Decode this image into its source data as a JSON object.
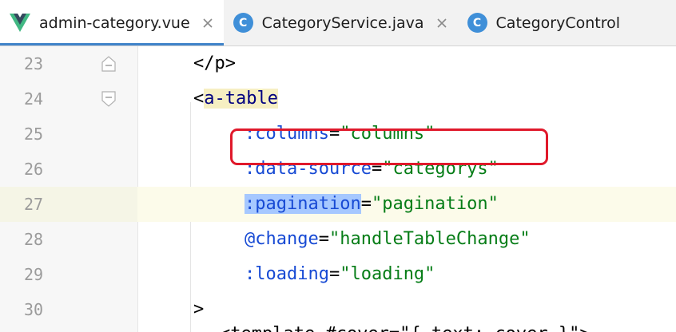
{
  "tabs": [
    {
      "label": "admin-category.vue",
      "icon": "vue-icon",
      "active": true
    },
    {
      "label": "CategoryService.java",
      "icon": "class-icon",
      "active": false
    },
    {
      "label": "CategoryControl",
      "icon": "class-icon",
      "active": false
    }
  ],
  "class_icon_letter": "C",
  "close_glyph": "✕",
  "editor": {
    "lines": [
      {
        "number": "23",
        "tokens": [
          {
            "t": "</p>",
            "k": "punc"
          }
        ]
      },
      {
        "number": "24",
        "tokens": [
          {
            "t": "<",
            "k": "punc"
          },
          {
            "t": "a-table",
            "k": "tag"
          }
        ]
      },
      {
        "number": "25",
        "tokens": [
          {
            "t": ":columns",
            "k": "attr"
          },
          {
            "t": "=",
            "k": "eq"
          },
          {
            "t": "\"columns\"",
            "k": "val"
          }
        ]
      },
      {
        "number": "26",
        "tokens": [
          {
            "t": ":data-source",
            "k": "attr"
          },
          {
            "t": "=",
            "k": "eq"
          },
          {
            "t": "\"categorys\"",
            "k": "val"
          }
        ]
      },
      {
        "number": "27",
        "tokens": [
          {
            "t": ":pagination",
            "k": "attr-sel"
          },
          {
            "t": "=",
            "k": "eq"
          },
          {
            "t": "\"pagination\"",
            "k": "val"
          }
        ]
      },
      {
        "number": "28",
        "tokens": [
          {
            "t": "@change",
            "k": "ev"
          },
          {
            "t": "=",
            "k": "eq"
          },
          {
            "t": "\"handleTableChange\"",
            "k": "val"
          }
        ]
      },
      {
        "number": "29",
        "tokens": [
          {
            "t": ":loading",
            "k": "attr"
          },
          {
            "t": "=",
            "k": "eq"
          },
          {
            "t": "\"loading\"",
            "k": "val"
          }
        ]
      },
      {
        "number": "30",
        "tokens": [
          {
            "t": ">",
            "k": "punc"
          }
        ]
      }
    ],
    "partial_line": "<template #cover=\"{ text: cover }\">"
  },
  "colors": {
    "tab_active_underline": "#4083c9",
    "highlight_box": "#e0192b",
    "selection": "#a6c8ff",
    "string": "#067d17",
    "attribute": "#174ad4",
    "tag": "#000080"
  }
}
